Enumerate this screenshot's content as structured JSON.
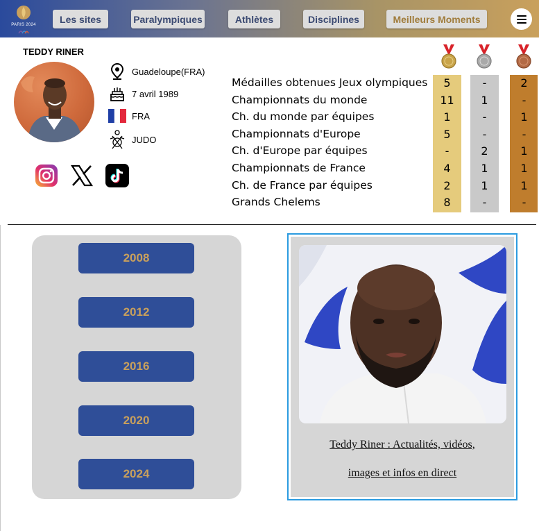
{
  "header": {
    "logo": {
      "text": "PARIS 2024",
      "icon": "paris-2024-flame-logo"
    },
    "nav": [
      {
        "label": "Les sites",
        "accent": "#3b4a72"
      },
      {
        "label": "Paralympiques",
        "accent": "#3b4a72"
      },
      {
        "label": "Athlètes",
        "accent": "#3b4a72"
      },
      {
        "label": "Disciplines",
        "accent": "#3b4a72"
      },
      {
        "label": "Meilleurs Moments",
        "accent": "#a07c3c"
      }
    ],
    "menu_icon": "hamburger-icon"
  },
  "athlete": {
    "name": "TEDDY RINER",
    "birthplace": "Guadeloupe(FRA)",
    "birthdate": "7 avril 1989",
    "country": "FRA",
    "sport": "JUDO"
  },
  "social": [
    {
      "name": "instagram",
      "icon": "instagram-icon"
    },
    {
      "name": "x",
      "icon": "x-icon"
    },
    {
      "name": "tiktok",
      "icon": "tiktok-icon"
    }
  ],
  "medals": {
    "columns": [
      {
        "name": "gold",
        "color": "#e5cb7c"
      },
      {
        "name": "silver",
        "color": "#c9c9c9"
      },
      {
        "name": "bronze",
        "color": "#bf7d2d"
      }
    ],
    "rows": [
      {
        "label": "Médailles obtenues Jeux olympiques",
        "gold": "5",
        "silver": "-",
        "bronze": "2"
      },
      {
        "label": "Championnats du monde",
        "gold": "11",
        "silver": "1",
        "bronze": "-"
      },
      {
        "label": "Ch. du monde par équipes",
        "gold": "1",
        "silver": "-",
        "bronze": "1"
      },
      {
        "label": "Championnats d'Europe",
        "gold": "5",
        "silver": "-",
        "bronze": "-"
      },
      {
        "label": "Ch. d'Europe par équipes",
        "gold": "-",
        "silver": "2",
        "bronze": "1"
      },
      {
        "label": "Championnats de France",
        "gold": "4",
        "silver": "1",
        "bronze": "1"
      },
      {
        "label": "Ch. de France par équipes",
        "gold": "2",
        "silver": "1",
        "bronze": "1"
      },
      {
        "label": "Grands Chelems",
        "gold": "8",
        "silver": "-",
        "bronze": "-"
      }
    ]
  },
  "years": [
    "2008",
    "2012",
    "2016",
    "2020",
    "2024"
  ],
  "news": {
    "line1": "Teddy Riner : Actualités, vidéos,",
    "line2": "images et infos en direct"
  },
  "colors": {
    "header_start": "#2a4a9c",
    "header_end": "#c9a05c",
    "year_button": "#2f4e98",
    "year_text": "#c9a05c",
    "card_border": "#2b9be0"
  }
}
